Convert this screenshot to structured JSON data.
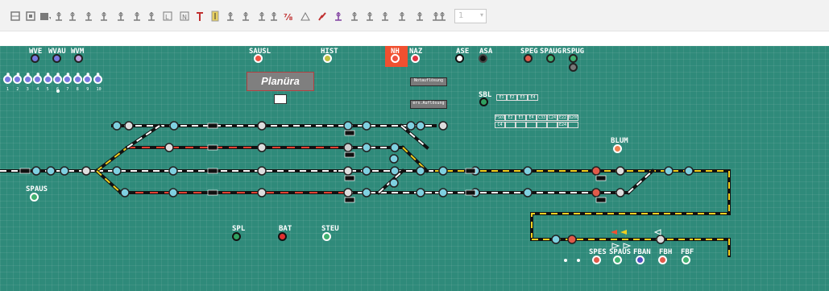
{
  "panel": {
    "title": "Planüra",
    "buttons": {
      "notauf": "Notauflösung",
      "ers_auf": "ers.Auflösung"
    },
    "top_signals": {
      "wve": "WVE",
      "wvau": "WVAU",
      "wvm": "WVM",
      "sausl": "SAUSL",
      "hist": "HIST",
      "nh": "NH",
      "naz": "NAZ",
      "ase": "ASE",
      "asa": "ASA",
      "speg": "SPEG",
      "spaug": "SPAUG",
      "rspug": "RSPUG",
      "sbl": "SBL",
      "blum": "BLUM",
      "spaus": "SPAUS"
    },
    "numbers": [
      "1",
      "2",
      "3",
      "4",
      "5",
      "6",
      "7",
      "8",
      "9",
      "10"
    ],
    "bottom_signals": {
      "spl": "SPL",
      "bat": "BAT",
      "steu": "STEU",
      "spes": "SPES",
      "spaus": "SPAUS",
      "fban": "FBAN",
      "fbh": "FBH",
      "fbf": "FBF"
    },
    "sbl_grid": {
      "row1": [
        "E1",
        "E2",
        "E3",
        "E4"
      ],
      "row2": [
        "FSO1",
        "E2",
        "E3",
        "E4",
        "C33",
        "C24",
        "E22",
        "B200"
      ],
      "row3": [
        "C4",
        "",
        "",
        "",
        "",
        "",
        "E24",
        ""
      ]
    }
  },
  "toolbar": {
    "combo_value": "1"
  }
}
